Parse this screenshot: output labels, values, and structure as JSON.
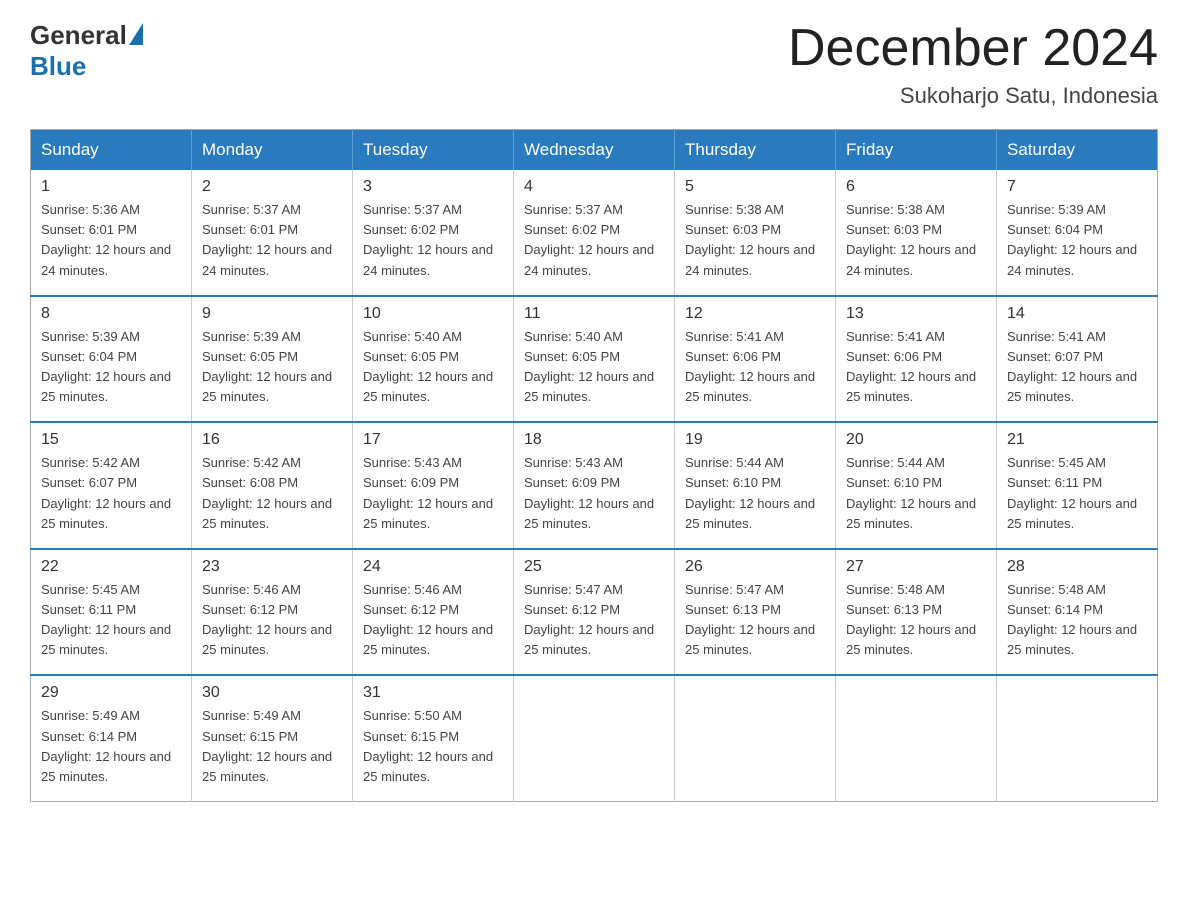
{
  "logo": {
    "general": "General",
    "blue": "Blue"
  },
  "title": "December 2024",
  "location": "Sukoharjo Satu, Indonesia",
  "header": {
    "days": [
      "Sunday",
      "Monday",
      "Tuesday",
      "Wednesday",
      "Thursday",
      "Friday",
      "Saturday"
    ]
  },
  "weeks": [
    [
      {
        "day": "1",
        "sunrise": "5:36 AM",
        "sunset": "6:01 PM",
        "daylight": "12 hours and 24 minutes."
      },
      {
        "day": "2",
        "sunrise": "5:37 AM",
        "sunset": "6:01 PM",
        "daylight": "12 hours and 24 minutes."
      },
      {
        "day": "3",
        "sunrise": "5:37 AM",
        "sunset": "6:02 PM",
        "daylight": "12 hours and 24 minutes."
      },
      {
        "day": "4",
        "sunrise": "5:37 AM",
        "sunset": "6:02 PM",
        "daylight": "12 hours and 24 minutes."
      },
      {
        "day": "5",
        "sunrise": "5:38 AM",
        "sunset": "6:03 PM",
        "daylight": "12 hours and 24 minutes."
      },
      {
        "day": "6",
        "sunrise": "5:38 AM",
        "sunset": "6:03 PM",
        "daylight": "12 hours and 24 minutes."
      },
      {
        "day": "7",
        "sunrise": "5:39 AM",
        "sunset": "6:04 PM",
        "daylight": "12 hours and 24 minutes."
      }
    ],
    [
      {
        "day": "8",
        "sunrise": "5:39 AM",
        "sunset": "6:04 PM",
        "daylight": "12 hours and 25 minutes."
      },
      {
        "day": "9",
        "sunrise": "5:39 AM",
        "sunset": "6:05 PM",
        "daylight": "12 hours and 25 minutes."
      },
      {
        "day": "10",
        "sunrise": "5:40 AM",
        "sunset": "6:05 PM",
        "daylight": "12 hours and 25 minutes."
      },
      {
        "day": "11",
        "sunrise": "5:40 AM",
        "sunset": "6:05 PM",
        "daylight": "12 hours and 25 minutes."
      },
      {
        "day": "12",
        "sunrise": "5:41 AM",
        "sunset": "6:06 PM",
        "daylight": "12 hours and 25 minutes."
      },
      {
        "day": "13",
        "sunrise": "5:41 AM",
        "sunset": "6:06 PM",
        "daylight": "12 hours and 25 minutes."
      },
      {
        "day": "14",
        "sunrise": "5:41 AM",
        "sunset": "6:07 PM",
        "daylight": "12 hours and 25 minutes."
      }
    ],
    [
      {
        "day": "15",
        "sunrise": "5:42 AM",
        "sunset": "6:07 PM",
        "daylight": "12 hours and 25 minutes."
      },
      {
        "day": "16",
        "sunrise": "5:42 AM",
        "sunset": "6:08 PM",
        "daylight": "12 hours and 25 minutes."
      },
      {
        "day": "17",
        "sunrise": "5:43 AM",
        "sunset": "6:09 PM",
        "daylight": "12 hours and 25 minutes."
      },
      {
        "day": "18",
        "sunrise": "5:43 AM",
        "sunset": "6:09 PM",
        "daylight": "12 hours and 25 minutes."
      },
      {
        "day": "19",
        "sunrise": "5:44 AM",
        "sunset": "6:10 PM",
        "daylight": "12 hours and 25 minutes."
      },
      {
        "day": "20",
        "sunrise": "5:44 AM",
        "sunset": "6:10 PM",
        "daylight": "12 hours and 25 minutes."
      },
      {
        "day": "21",
        "sunrise": "5:45 AM",
        "sunset": "6:11 PM",
        "daylight": "12 hours and 25 minutes."
      }
    ],
    [
      {
        "day": "22",
        "sunrise": "5:45 AM",
        "sunset": "6:11 PM",
        "daylight": "12 hours and 25 minutes."
      },
      {
        "day": "23",
        "sunrise": "5:46 AM",
        "sunset": "6:12 PM",
        "daylight": "12 hours and 25 minutes."
      },
      {
        "day": "24",
        "sunrise": "5:46 AM",
        "sunset": "6:12 PM",
        "daylight": "12 hours and 25 minutes."
      },
      {
        "day": "25",
        "sunrise": "5:47 AM",
        "sunset": "6:12 PM",
        "daylight": "12 hours and 25 minutes."
      },
      {
        "day": "26",
        "sunrise": "5:47 AM",
        "sunset": "6:13 PM",
        "daylight": "12 hours and 25 minutes."
      },
      {
        "day": "27",
        "sunrise": "5:48 AM",
        "sunset": "6:13 PM",
        "daylight": "12 hours and 25 minutes."
      },
      {
        "day": "28",
        "sunrise": "5:48 AM",
        "sunset": "6:14 PM",
        "daylight": "12 hours and 25 minutes."
      }
    ],
    [
      {
        "day": "29",
        "sunrise": "5:49 AM",
        "sunset": "6:14 PM",
        "daylight": "12 hours and 25 minutes."
      },
      {
        "day": "30",
        "sunrise": "5:49 AM",
        "sunset": "6:15 PM",
        "daylight": "12 hours and 25 minutes."
      },
      {
        "day": "31",
        "sunrise": "5:50 AM",
        "sunset": "6:15 PM",
        "daylight": "12 hours and 25 minutes."
      },
      null,
      null,
      null,
      null
    ]
  ],
  "labels": {
    "sunrise_prefix": "Sunrise: ",
    "sunset_prefix": "Sunset: ",
    "daylight_prefix": "Daylight: "
  }
}
